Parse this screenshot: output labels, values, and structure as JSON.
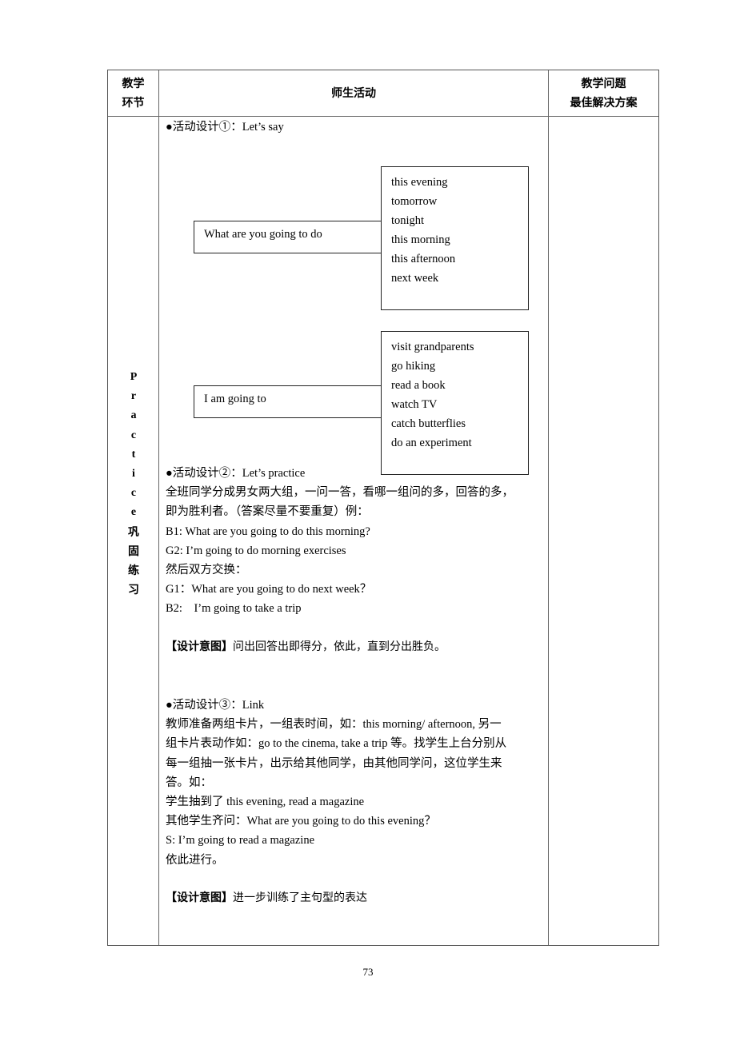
{
  "table": {
    "header": {
      "col1": [
        "教学",
        "环节"
      ],
      "col2": "师生活动",
      "col3": [
        "教学问题",
        "最佳解决方案"
      ]
    },
    "section_label": {
      "letters": [
        "P",
        "r",
        "a",
        "c",
        "t",
        "i",
        "c",
        "e"
      ],
      "chinese": [
        "巩",
        "固",
        "练",
        "习"
      ]
    },
    "activity1": {
      "title": "●活动设计①：Let’s say",
      "diagram1": {
        "stem": "What are you going to do",
        "options": [
          "this evening",
          "tomorrow",
          "tonight",
          "this morning",
          "this afternoon",
          "next week"
        ]
      },
      "diagram2": {
        "stem": "I am going to",
        "options": [
          "visit grandparents",
          "go hiking",
          "read a book",
          "watch TV",
          "catch butterflies",
          "do an experiment"
        ]
      }
    },
    "activity2": {
      "title": "●活动设计②：Let’s practice",
      "lines": [
        "全班同学分成男女两大组，一问一答，看哪一组问的多，回答的多，",
        "即为胜利者。（答案尽量不要重复）例：",
        "B1: What are you going to do this morning?",
        "G2: I’m going to do morning exercises",
        "然后双方交换：",
        "G1：What are you going to do next week？",
        "B2:　I’m going to take a trip"
      ],
      "intent_label": "【设计意图】",
      "intent_text": "问出回答出即得分，依此，直到分出胜负。"
    },
    "activity3": {
      "title": "●活动设计③：Link",
      "lines": [
        "教师准备两组卡片，一组表时间，如：this morning/ afternoon,  另一",
        "组卡片表动作如：go to the cinema, take a trip 等。找学生上台分别从",
        "每一组抽一张卡片，出示给其他同学，由其他同学问，这位学生来",
        "答。如：",
        "学生抽到了 this evening, read a magazine",
        "其他学生齐问：What are you going to do this evening？",
        "S: I’m going to read a magazine",
        "依此进行。"
      ],
      "intent_label": "【设计意图】",
      "intent_text": "进一步训练了主句型的表达"
    }
  },
  "page_number": "73"
}
